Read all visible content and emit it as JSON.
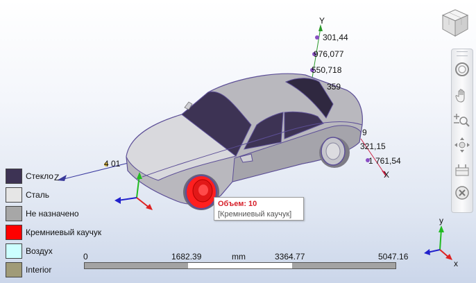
{
  "axes": {
    "y_label": "Y",
    "x_label": "X",
    "z_label": "Z",
    "y_ticks": [
      "301,44",
      "976,077",
      "550,718",
      "359"
    ],
    "x_ticks": [
      "9",
      "321,15",
      "1 761,54"
    ],
    "z_ticks": [
      "4 01"
    ]
  },
  "legend": {
    "items": [
      {
        "label": "Стекло",
        "color": "#3d3354"
      },
      {
        "label": "Сталь",
        "color": "#e6e6e6"
      },
      {
        "label": "Не назначено",
        "color": "#a7a7a7"
      },
      {
        "label": "Кремниевый каучук",
        "color": "#ff0000"
      },
      {
        "label": "Воздух",
        "color": "#ccffff"
      },
      {
        "label": "Interior",
        "color": "#a09b78"
      }
    ]
  },
  "tooltip": {
    "title": "Объем: 10",
    "subtitle": "[Кремниевый каучук]"
  },
  "scale": {
    "ticks": [
      "0",
      "1682.39",
      "3364.77",
      "5047.16"
    ],
    "unit": "mm"
  },
  "triad": {
    "y_label": "y",
    "z_label": "z",
    "x_label": "x"
  },
  "toolbar": {
    "buttons": [
      "orbit-icon",
      "pan-hand-icon",
      "zoom-icon",
      "fly-navigate-icon",
      "sectioning-icon",
      "close-x-icon"
    ]
  }
}
